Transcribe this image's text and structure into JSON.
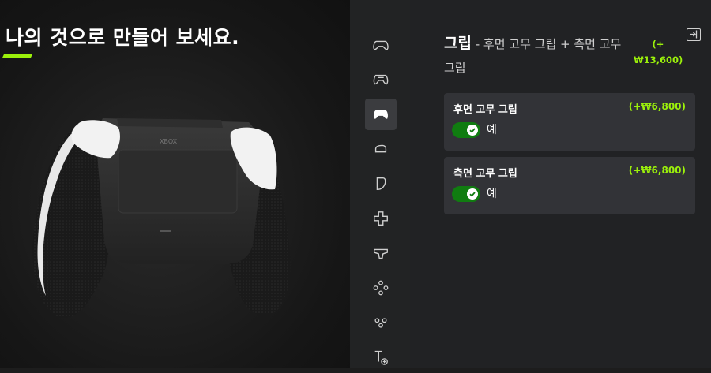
{
  "stage": {
    "title": "나의 것으로 만들어 보세요."
  },
  "toolbar": {
    "items": [
      {
        "icon": "controller-body-icon",
        "selected": false
      },
      {
        "icon": "controller-back-icon",
        "selected": false
      },
      {
        "icon": "controller-grip-icon",
        "selected": true
      },
      {
        "icon": "bumper-icon",
        "selected": false
      },
      {
        "icon": "trigger-icon",
        "selected": false
      },
      {
        "icon": "dpad-icon",
        "selected": false
      },
      {
        "icon": "thumbstick-icon",
        "selected": false
      },
      {
        "icon": "abxy-buttons-icon",
        "selected": false
      },
      {
        "icon": "view-menu-buttons-icon",
        "selected": false
      },
      {
        "icon": "engraving-text-icon",
        "selected": false
      }
    ]
  },
  "panel": {
    "title_main": "그립",
    "title_sub": "- 후면 고무 그립 + 측면 고무 그립",
    "price": "(+₩13,600)",
    "options": [
      {
        "name": "후면 고무 그립",
        "price": "(+₩6,800)",
        "toggle_label": "예",
        "enabled": true
      },
      {
        "name": "측면 고무 그립",
        "price": "(+₩6,800)",
        "toggle_label": "예",
        "enabled": true
      }
    ]
  },
  "colors": {
    "accent": "#9bf00b",
    "toggle_on": "#107c10",
    "card": "#323337"
  }
}
